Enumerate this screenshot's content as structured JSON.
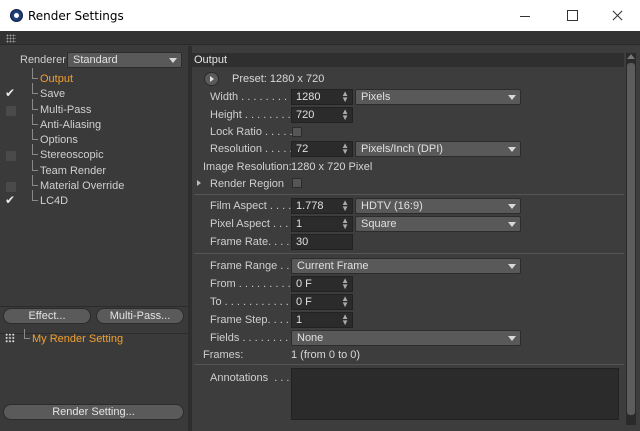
{
  "window": {
    "title": "Render Settings"
  },
  "left": {
    "renderer_label": "Renderer",
    "renderer_value": "Standard",
    "tree": [
      {
        "label": "Output",
        "checked": null,
        "active": true
      },
      {
        "label": "Save",
        "checked": true,
        "active": false
      },
      {
        "label": "Multi-Pass",
        "checked": false,
        "active": false
      },
      {
        "label": "Anti-Aliasing",
        "checked": null,
        "active": false
      },
      {
        "label": "Options",
        "checked": null,
        "active": false
      },
      {
        "label": "Stereoscopic",
        "checked": false,
        "active": false
      },
      {
        "label": "Team Render",
        "checked": null,
        "active": false
      },
      {
        "label": "Material Override",
        "checked": false,
        "active": false
      },
      {
        "label": "LC4D",
        "checked": true,
        "active": false
      }
    ],
    "effect_button": "Effect...",
    "multipass_button": "Multi-Pass...",
    "render_setting_item": "My Render Setting",
    "render_setting_button": "Render Setting..."
  },
  "output": {
    "section_title": "Output",
    "preset": "Preset: 1280 x 720",
    "width_label": "Width . . . . . . . . .",
    "width_value": "1280",
    "width_unit": "Pixels",
    "height_label": "Height . . . . . . . .",
    "height_value": "720",
    "lock_ratio_label": "Lock Ratio . . . . .",
    "resolution_label": "Resolution . . . . .",
    "resolution_value": "72",
    "resolution_unit": "Pixels/Inch (DPI)",
    "image_resolution_label": "Image Resolution:",
    "image_resolution_value": "1280 x 720 Pixel",
    "render_region_label": "Render Region",
    "film_aspect_label": "Film Aspect . . . . .",
    "film_aspect_value": "1.778",
    "film_aspect_preset": "HDTV (16:9)",
    "pixel_aspect_label": "Pixel Aspect . . . .",
    "pixel_aspect_value": "1",
    "pixel_aspect_preset": "Square",
    "frame_rate_label": "Frame Rate. . . . .",
    "frame_rate_value": "30",
    "frame_range_label": "Frame Range . . .",
    "frame_range_value": "Current Frame",
    "from_label": "From . . . . . . . . . .",
    "from_value": "0 F",
    "to_label": "To . . . . . . . . . . . .",
    "to_value": "0 F",
    "frame_step_label": "Frame Step. . . . .",
    "frame_step_value": "1",
    "fields_label": "Fields . . . . . . . . .",
    "fields_value": "None",
    "frames_label": "Frames:",
    "frames_value": "1 (from 0 to 0)",
    "annotations_label": "Annotations  . . ."
  },
  "colors": {
    "active_item": "#f0a030",
    "panel_bg": "#3d3d3d",
    "field_bg": "#2b2b2b"
  }
}
